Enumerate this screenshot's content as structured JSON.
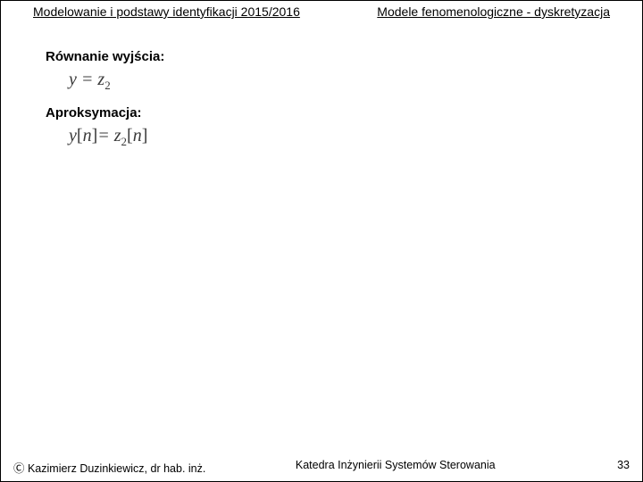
{
  "header": {
    "left": "Modelowanie i podstawy identyfikacji 2015/2016",
    "right": "Modele fenomenologiczne - dyskretyzacja"
  },
  "body": {
    "heading1": "Równanie  wyjścia:",
    "eq1_y": "y",
    "eq1_eq": " = ",
    "eq1_z": "z",
    "eq1_sub": "2",
    "heading2": "Aproksymacja:",
    "eq2_y": "y",
    "eq2_lb1": "[",
    "eq2_n1": "n",
    "eq2_rb1": "]",
    "eq2_eq": "= ",
    "eq2_z": "z",
    "eq2_sub": "2",
    "eq2_lb2": "[",
    "eq2_n2": "n",
    "eq2_rb2": "]"
  },
  "footer": {
    "left": "Ⓒ Kazimierz Duzinkiewicz, dr hab. inż.",
    "center": "Katedra Inżynierii Systemów Sterowania",
    "right": "33"
  }
}
